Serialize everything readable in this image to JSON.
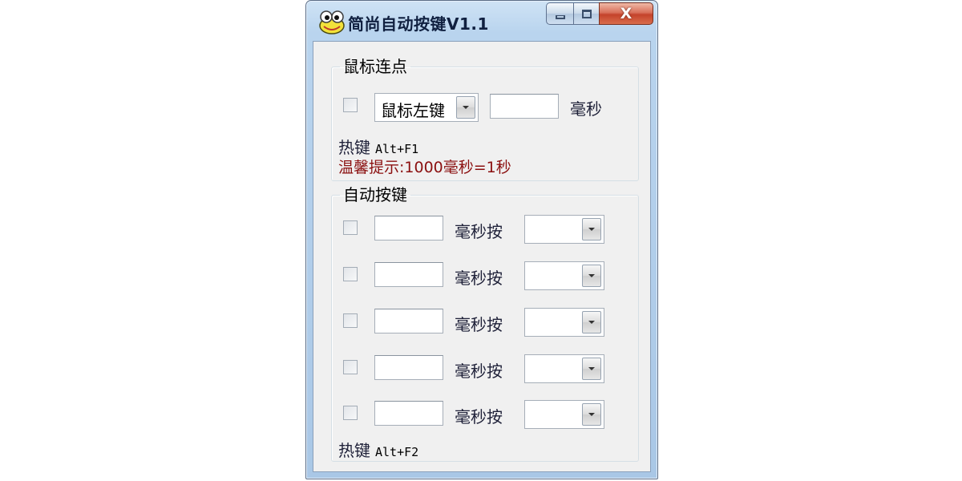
{
  "window": {
    "title": "简尚自动按键V1.1",
    "caption": {
      "close_glyph": "X"
    }
  },
  "mouse_group": {
    "legend": "鼠标连点",
    "checkbox_checked": false,
    "button_select": {
      "selected": "鼠标左键"
    },
    "interval_value": "",
    "unit_label": "毫秒",
    "hotkey_label": "热键",
    "hotkey_value": "Alt+F1",
    "tip": "温馨提示:1000毫秒=1秒"
  },
  "auto_group": {
    "legend": "自动按键",
    "rows": [
      {
        "checked": false,
        "interval": "",
        "label": "毫秒按",
        "key": ""
      },
      {
        "checked": false,
        "interval": "",
        "label": "毫秒按",
        "key": ""
      },
      {
        "checked": false,
        "interval": "",
        "label": "毫秒按",
        "key": ""
      },
      {
        "checked": false,
        "interval": "",
        "label": "毫秒按",
        "key": ""
      },
      {
        "checked": false,
        "interval": "",
        "label": "毫秒按",
        "key": ""
      }
    ],
    "hotkey_label": "热键",
    "hotkey_value": "Alt+F2"
  },
  "colors": {
    "tip_text": "#8b1010",
    "label_text": "#1e2038",
    "close_button": "#c4432b"
  },
  "icons": {
    "app": "frog-icon",
    "minimize": "minimize-icon",
    "maximize": "maximize-icon",
    "close": "close-icon",
    "combo_arrow": "chevron-down-icon"
  }
}
